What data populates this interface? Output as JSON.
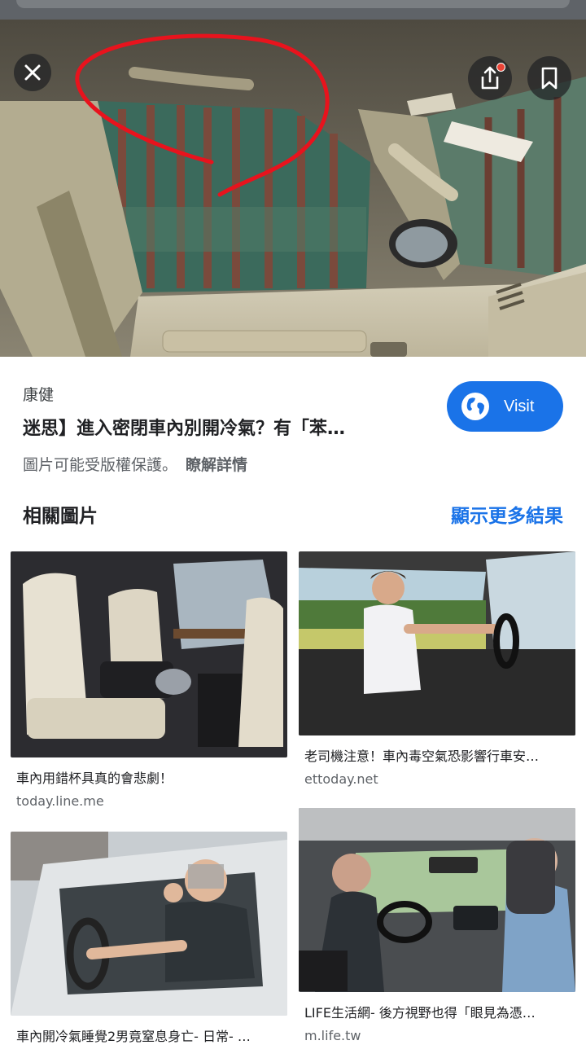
{
  "viewer": {
    "close_icon": "close-icon",
    "share_icon": "share-icon",
    "bookmark_icon": "bookmark-icon",
    "notification_color": "#ea4335"
  },
  "result": {
    "source": "康健",
    "title": "迷思】進入密閉車內別開冷氣？有「苯…",
    "visit_label": "Visit",
    "copyright_text": "圖片可能受版權保護。",
    "learn_more": "瞭解詳情"
  },
  "related": {
    "heading": "相關圖片",
    "show_more": "顯示更多結果",
    "items": [
      {
        "title": "車內用錯杯具真的會悲劇！",
        "site": "today.line.me"
      },
      {
        "title": "老司機注意！車內毒空氣恐影響行車安…",
        "site": "ettoday.net"
      },
      {
        "title": "車內開冷氣睡覺2男竟窒息身亡- 日常- …",
        "site": ""
      },
      {
        "title": "LIFE生活網- 後方視野也得「眼見為憑…",
        "site": "m.life.tw"
      }
    ]
  },
  "colors": {
    "accent": "#1a73e8",
    "text": "#202124",
    "muted": "#5f6368"
  }
}
